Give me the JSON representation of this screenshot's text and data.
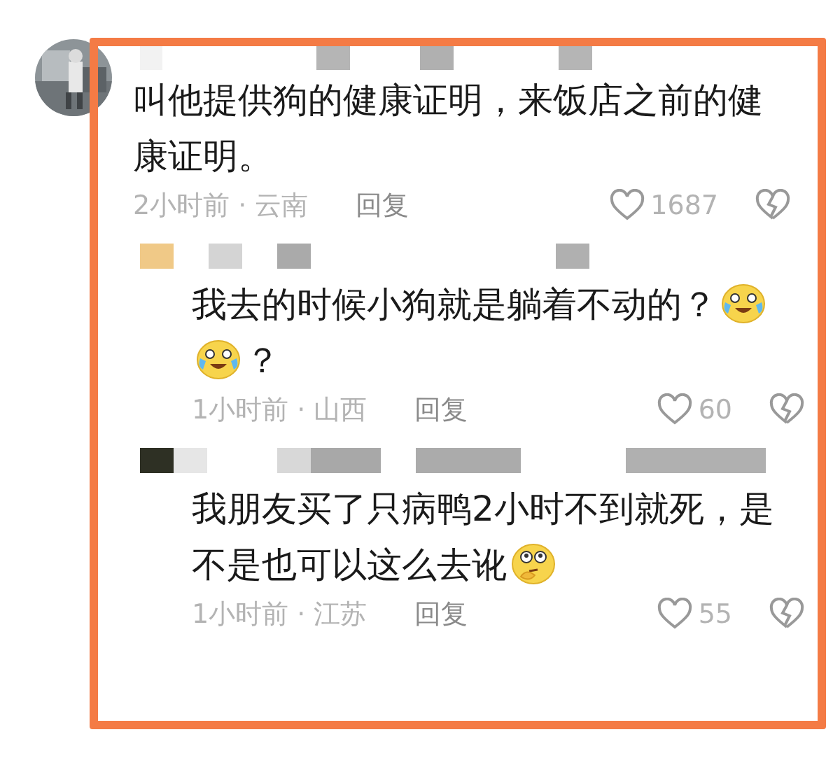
{
  "comments": [
    {
      "text": [
        {
          "kind": "text",
          "value": "叫他提供狗的健康证明，来饭店之前的健康证明。"
        }
      ],
      "time": "2小时前 · 云南",
      "reply": "回复",
      "likes": "1687",
      "children": [
        {
          "text": [
            {
              "kind": "text",
              "value": "我去的时候小狗就是躺着不动的？"
            },
            {
              "kind": "laughing-crying-emoji"
            },
            {
              "kind": "laughing-crying-emoji"
            },
            {
              "kind": "text",
              "value": "？"
            }
          ],
          "time": "1小时前 · 山西",
          "reply": "回复",
          "likes": "60"
        },
        {
          "text": [
            {
              "kind": "text",
              "value": "我朋友买了只病鸭2小时不到就死，是"
            },
            {
              "kind": "text",
              "value": "不是也可以这么去讹"
            },
            {
              "kind": "thinking-emoji"
            }
          ],
          "time": "1小时前 · 江苏",
          "reply": "回复",
          "likes": "55"
        }
      ]
    }
  ]
}
